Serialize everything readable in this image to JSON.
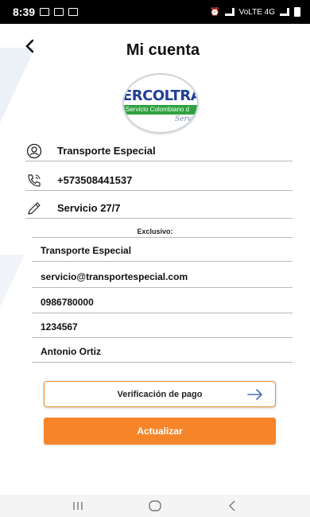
{
  "status_bar": {
    "time": "8:39",
    "network_label": "VoLTE 4G"
  },
  "header": {
    "title": "Mi cuenta",
    "back_icon": "chevron-left-icon"
  },
  "logo": {
    "main_text": "ERCOLTRAN",
    "band_text": "Servicio Colombiano d",
    "script_text": "Servi"
  },
  "profile_fields": [
    {
      "icon": "user-icon",
      "value": "Transporte Especial"
    },
    {
      "icon": "phone-icon",
      "value": "+573508441537"
    },
    {
      "icon": "pencil-icon",
      "value": "Servicio 27/7"
    }
  ],
  "exclusive": {
    "label": "Exclusivo:",
    "rows": [
      "Transporte Especial",
      "servicio@transportespecial.com",
      "0986780000",
      "1234567",
      "Antonio Ortiz"
    ]
  },
  "buttons": {
    "verify_label": "Verificación de pago",
    "update_label": "Actualizar"
  },
  "nav": {
    "recent_icon": "recent-apps-icon",
    "home_icon": "home-icon",
    "back_icon": "back-icon"
  },
  "colors": {
    "accent": "#f6852a",
    "accent_border": "#e68a27",
    "arrow": "#4a6fb0",
    "logo_blue": "#1f3f95",
    "logo_green": "#2ea23e"
  }
}
